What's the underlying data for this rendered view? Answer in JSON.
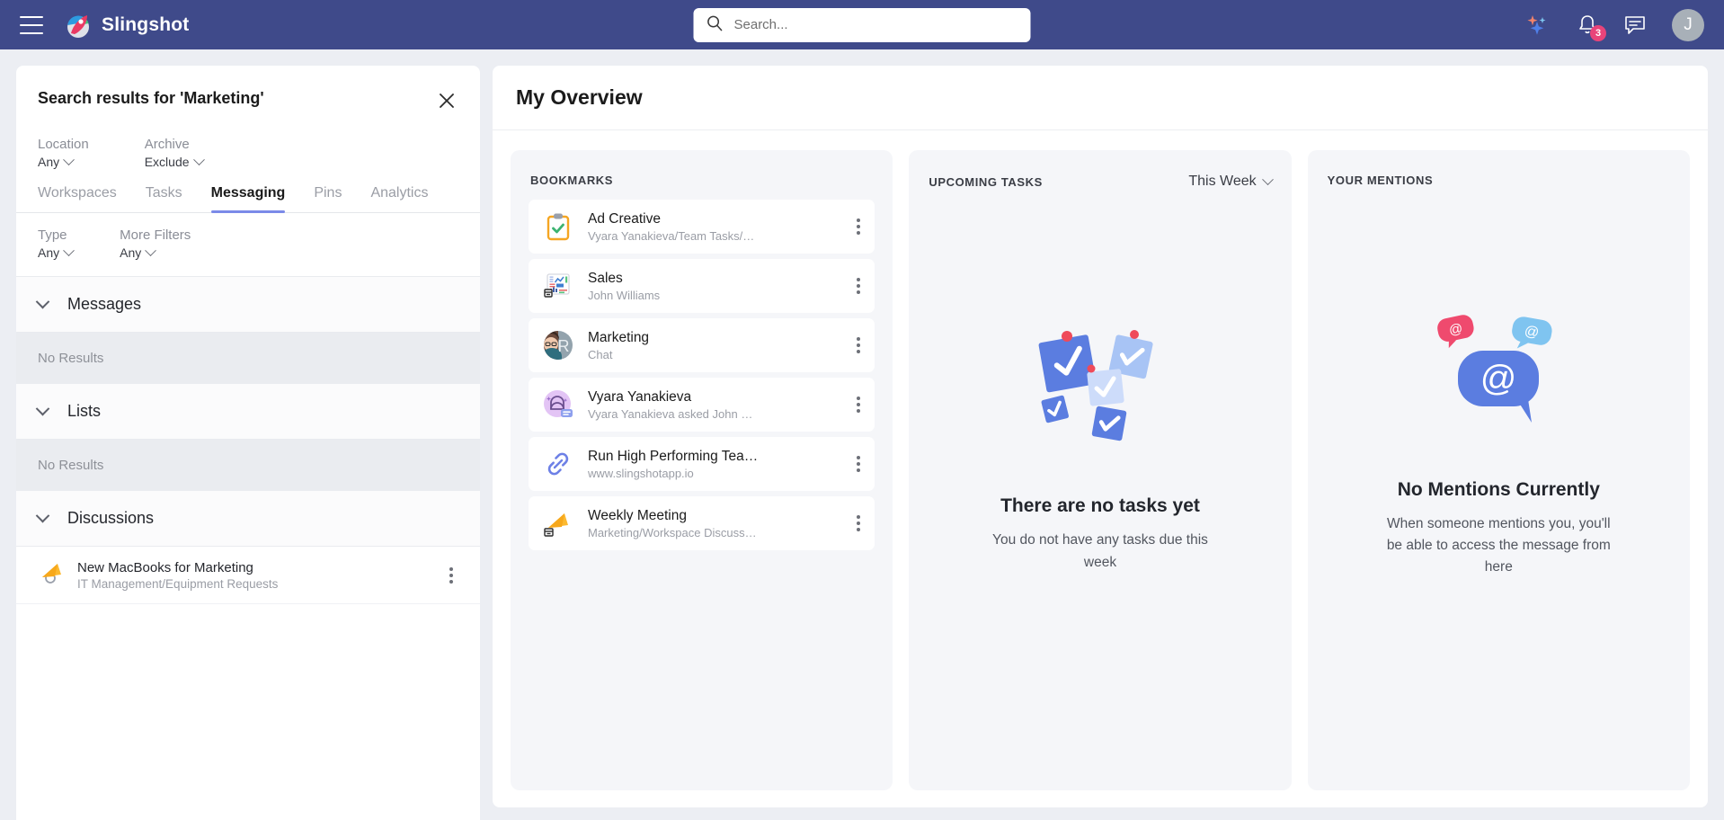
{
  "topbar": {
    "menu_icon": "hamburger-icon",
    "brand": "Slingshot",
    "search_placeholder": "Search...",
    "search_value": "",
    "search_icon": "search-icon",
    "ai_icon": "sparkles-icon",
    "notifications_icon": "bell-icon",
    "notifications_count": "3",
    "messages_icon": "chat-icon",
    "avatar_initial": "J",
    "accent": "#3f4a8a"
  },
  "search_panel": {
    "title": "Search results for 'Marketing'",
    "close_icon": "close-icon",
    "filters_top": [
      {
        "label": "Location",
        "value": "Any"
      },
      {
        "label": "Archive",
        "value": "Exclude"
      }
    ],
    "tabs": [
      {
        "label": "Workspaces",
        "active": false
      },
      {
        "label": "Tasks",
        "active": false
      },
      {
        "label": "Messaging",
        "active": true
      },
      {
        "label": "Pins",
        "active": false
      },
      {
        "label": "Analytics",
        "active": false
      }
    ],
    "filters_bottom": [
      {
        "label": "Type",
        "value": "Any"
      },
      {
        "label": "More Filters",
        "value": "Any"
      }
    ],
    "sections": [
      {
        "title": "Messages",
        "empty_text": "No Results"
      },
      {
        "title": "Lists",
        "empty_text": "No Results"
      },
      {
        "title": "Discussions",
        "empty_text": ""
      }
    ],
    "discussion_results": [
      {
        "icon": "megaphone-icon",
        "title": "New MacBooks for Marketing",
        "subtitle": "IT Management/Equipment Requests"
      }
    ]
  },
  "overview": {
    "title": "My Overview",
    "bookmarks": {
      "title": "BOOKMARKS",
      "items": [
        {
          "icon": "clipboard-task-icon",
          "name": "Ad Creative",
          "subtitle": "Vyara Yanakieva/Team Tasks/…"
        },
        {
          "icon": "dashboard-chart-icon",
          "name": "Sales",
          "subtitle": "John Williams"
        },
        {
          "icon": "chat-avatar-icon",
          "name": "Marketing",
          "subtitle": "Chat"
        },
        {
          "icon": "discussion-icon",
          "name": "Vyara Yanakieva",
          "subtitle": "Vyara Yanakieva asked John …"
        },
        {
          "icon": "link-icon",
          "name": "Run High Performing Tea…",
          "subtitle": "www.slingshotapp.io"
        },
        {
          "icon": "megaphone-icon",
          "name": "Weekly Meeting",
          "subtitle": "Marketing/Workspace Discuss…"
        }
      ],
      "menu_icon": "kebab-menu-icon"
    },
    "upcoming_tasks": {
      "title": "UPCOMING TASKS",
      "range_value": "This Week",
      "range_icon": "chevron-down-icon",
      "art": "tasks-empty-illustration",
      "empty_title": "There are no tasks yet",
      "empty_subtitle": "You do not have any tasks due this week"
    },
    "your_mentions": {
      "title": "YOUR MENTIONS",
      "art": "mentions-empty-illustration",
      "empty_title": "No Mentions Currently",
      "empty_subtitle": "When someone mentions you, you'll be able to access the message from here"
    }
  }
}
